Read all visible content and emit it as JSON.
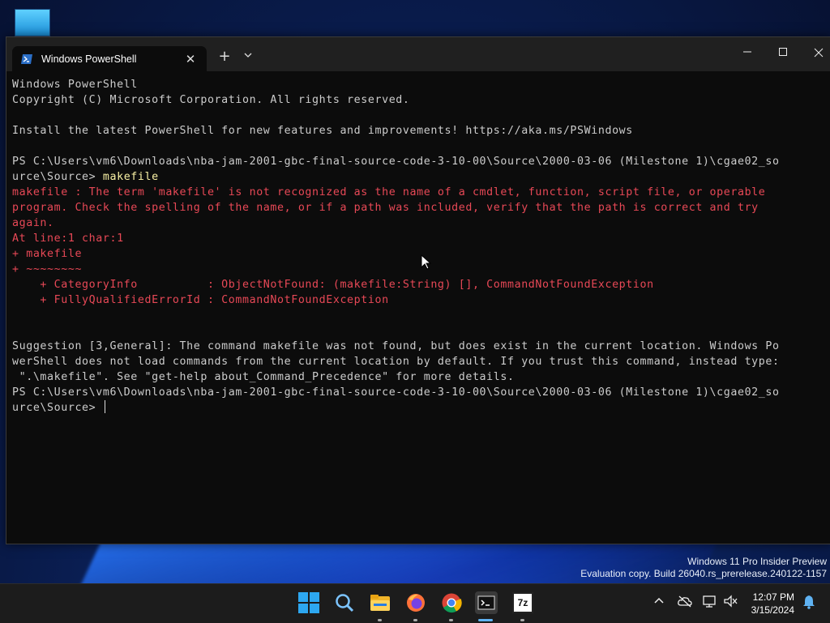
{
  "window": {
    "tab_title": "Windows PowerShell",
    "new_tab_glyph": "+",
    "close_tab_glyph": "✕"
  },
  "console": {
    "lines": [
      {
        "text": "Windows PowerShell",
        "kind": "normal"
      },
      {
        "text": "Copyright (C) Microsoft Corporation. All rights reserved.",
        "kind": "normal"
      },
      {
        "text": "",
        "kind": "normal"
      },
      {
        "text": "Install the latest PowerShell for new features and improvements! https://aka.ms/PSWindows",
        "kind": "normal"
      },
      {
        "text": "",
        "kind": "normal"
      },
      {
        "text": "PS C:\\Users\\vm6\\Downloads\\nba-jam-2001-gbc-final-source-code-3-10-00\\Source\\2000-03-06 (Milestone 1)\\cgae02_so",
        "kind": "normal"
      },
      {
        "text": "urce\\Source> ",
        "kind": "prompt",
        "command": "makefile"
      },
      {
        "text": "makefile : The term 'makefile' is not recognized as the name of a cmdlet, function, script file, or operable",
        "kind": "error"
      },
      {
        "text": "program. Check the spelling of the name, or if a path was included, verify that the path is correct and try",
        "kind": "error"
      },
      {
        "text": "again.",
        "kind": "error"
      },
      {
        "text": "At line:1 char:1",
        "kind": "error"
      },
      {
        "text": "+ makefile",
        "kind": "error"
      },
      {
        "text": "+ ~~~~~~~~",
        "kind": "error"
      },
      {
        "text": "    + CategoryInfo          : ObjectNotFound: (makefile:String) [], CommandNotFoundException",
        "kind": "error"
      },
      {
        "text": "    + FullyQualifiedErrorId : CommandNotFoundException",
        "kind": "error"
      },
      {
        "text": "",
        "kind": "normal"
      },
      {
        "text": "",
        "kind": "normal"
      },
      {
        "text": "Suggestion [3,General]: The command makefile was not found, but does exist in the current location. Windows Po",
        "kind": "normal"
      },
      {
        "text": "werShell does not load commands from the current location by default. If you trust this command, instead type:",
        "kind": "normal"
      },
      {
        "text": " \".\\makefile\". See \"get-help about_Command_Precedence\" for more details.",
        "kind": "normal"
      },
      {
        "text": "PS C:\\Users\\vm6\\Downloads\\nba-jam-2001-gbc-final-source-code-3-10-00\\Source\\2000-03-06 (Milestone 1)\\cgae02_so",
        "kind": "normal"
      },
      {
        "text": "urce\\Source> ",
        "kind": "cursor"
      }
    ]
  },
  "watermark": {
    "line1": "Windows 11 Pro Insider Preview",
    "line2": "Evaluation copy. Build 26040.rs_prerelease.240122-1157"
  },
  "taskbar": {
    "time": "12:07 PM",
    "date": "3/15/2024",
    "apps": [
      "start-icon",
      "search-icon",
      "file-explorer-icon",
      "firefox-icon",
      "chrome-icon",
      "terminal-icon",
      "7zip-icon"
    ],
    "sevenzip_label": "7z"
  },
  "colors": {
    "console_bg": "#0c0c0c",
    "console_text": "#cccccc",
    "error_text": "#e74856",
    "command_text": "#f9f1a5",
    "accent": "#5fb2f2"
  }
}
